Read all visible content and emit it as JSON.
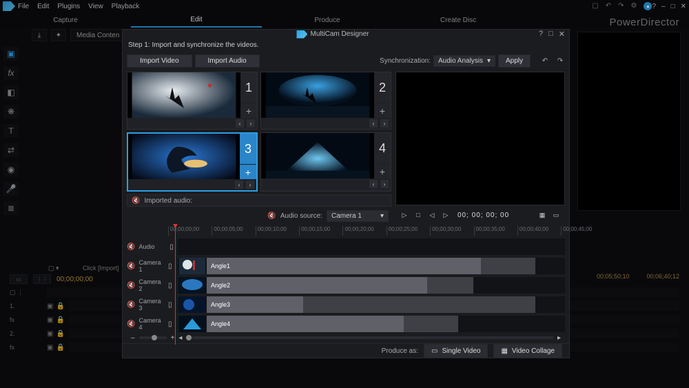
{
  "menu": {
    "items": [
      "File",
      "Edit",
      "Plugins",
      "View",
      "Playback"
    ]
  },
  "title_icons": {
    "help": "?",
    "min": "–",
    "close": "✕"
  },
  "tabs": {
    "items": [
      "Capture",
      "Edit",
      "Produce",
      "Create Disc"
    ],
    "active": 1
  },
  "brand": "PowerDirector",
  "toolbar": {
    "media": "Media Conten"
  },
  "host_timeline": {
    "clip_text": "Click [Import]",
    "time": "00;00;00;00",
    "peek_left": "00;05;50;10",
    "peek_right": "00;06;40;12",
    "tracks": {
      "t1": "1.",
      "t2": "fx",
      "t3": "2.",
      "t4": "fx"
    }
  },
  "modal": {
    "title": "MultiCam Designer",
    "step": "Step 1: Import and synchronize the videos.",
    "import_video": "Import Video",
    "import_audio": "Import Audio",
    "sync_label": "Synchronization:",
    "sync_value": "Audio Analysis",
    "apply": "Apply",
    "cameras": {
      "c1": "1",
      "c2": "2",
      "c3": "3",
      "c4": "4",
      "plus": "+"
    },
    "imported_audio": "Imported audio:",
    "audio_source_label": "Audio source:",
    "audio_source_value": "Camera 1",
    "transport": {
      "timecode": "00; 00; 00; 00"
    },
    "ruler": {
      "ticks": [
        "00;00;00;00",
        "00;00;05;00",
        "00;00;10;00",
        "00;00;15;00",
        "00;00;20;00",
        "00;00;25;00",
        "00;00;30;00",
        "00;00;35;00",
        "00;00;40;00",
        "00;00;45;00"
      ]
    },
    "tracks": {
      "audio": "Audio",
      "cam1": "Camera 1",
      "cam2": "Camera 2",
      "cam3": "Camera 3",
      "cam4": "Camera 4",
      "angle1": "Angle1",
      "angle2": "Angle2",
      "angle3": "Angle3",
      "angle4": "Angle4"
    },
    "footer": {
      "produce_as": "Produce as:",
      "single": "Single Video",
      "collage": "Video Collage"
    }
  }
}
